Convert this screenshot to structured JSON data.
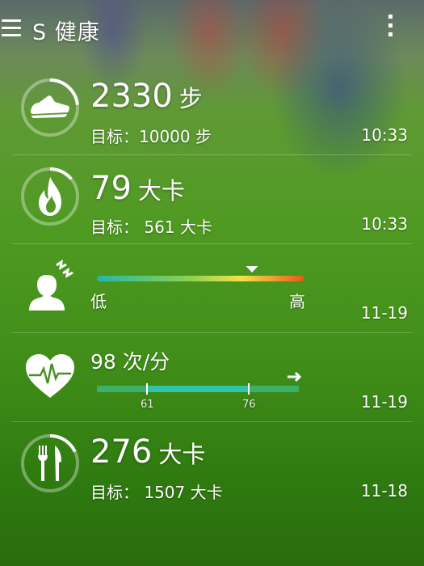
{
  "header": {
    "title": "S 健康",
    "menu_icon": "hamburger-menu-icon",
    "more_icon": "vertical-dots-icon"
  },
  "cards": [
    {
      "icon": "running-shoe-icon",
      "value": "2330",
      "unit": "步",
      "goal": "目标：10000 步",
      "time": "10:33",
      "progress": 0.233
    },
    {
      "icon": "flame-icon",
      "value": "79",
      "unit": "大卡",
      "goal": "目标： 561 大卡",
      "time": "10:33",
      "progress": 0.14
    },
    {
      "icon": "stress-head-icon",
      "low_label": "低",
      "high_label": "高",
      "time": "11-19",
      "level": 0.75
    },
    {
      "icon": "heart-rate-icon",
      "value_text": "98 次/分",
      "range_low": "61",
      "range_high": "76",
      "time": "11-19"
    },
    {
      "icon": "fork-knife-icon",
      "value": "276",
      "unit": "大卡",
      "goal": "目标： 1507 大卡",
      "time": "11-18",
      "progress": 0.18
    }
  ]
}
